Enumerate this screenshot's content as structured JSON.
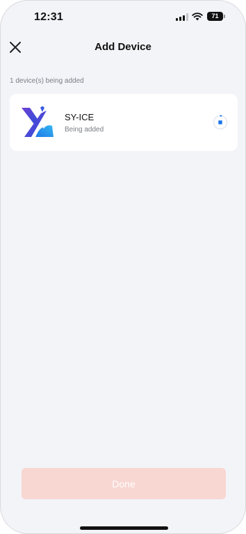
{
  "status_bar": {
    "time": "12:31",
    "battery_level": "71",
    "icons": [
      "signal-icon",
      "wifi-icon",
      "battery-icon"
    ]
  },
  "header": {
    "title": "Add Device",
    "close_icon": "close-icon"
  },
  "main": {
    "caption": "1 device(s) being added",
    "devices": [
      {
        "name": "SY-ICE",
        "status": "Being added",
        "logo_icon": "sy-ice-logo",
        "action_icon": "stop-icon"
      }
    ]
  },
  "footer": {
    "done_label": "Done",
    "done_enabled": false
  },
  "colors": {
    "background": "#f3f4f8",
    "card": "#ffffff",
    "accent_blue": "#1a73e8",
    "done_disabled_bg": "#f8d6d1",
    "secondary_text": "#7a7d85"
  }
}
